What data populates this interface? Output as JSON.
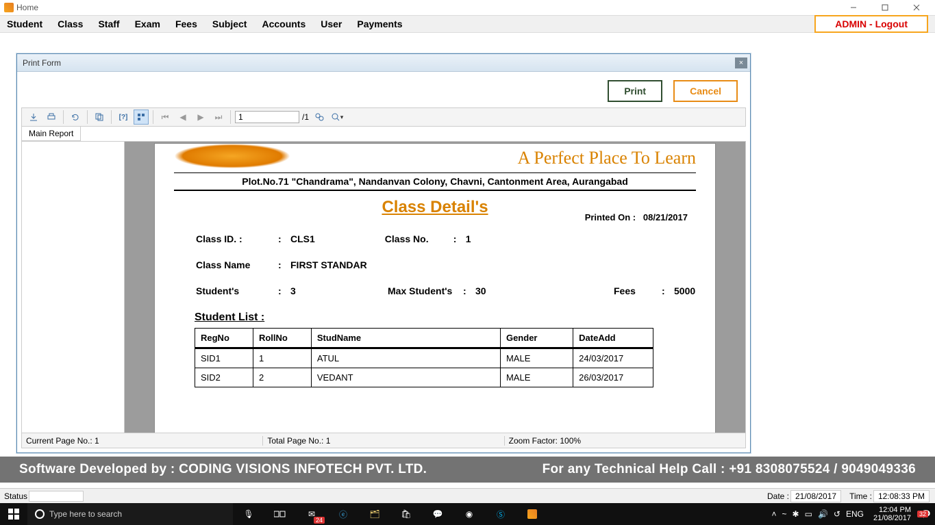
{
  "window": {
    "title": "Home"
  },
  "menu": {
    "items": [
      "Student",
      "Class",
      "Staff",
      "Exam",
      "Fees",
      "Subject",
      "Accounts",
      "User",
      "Payments"
    ],
    "admin_logout": "ADMIN - Logout"
  },
  "modal": {
    "title": "Print Form",
    "print": "Print",
    "cancel": "Cancel",
    "toolbar": {
      "page_val": "1",
      "page_total": "/1"
    },
    "tab": "Main Report",
    "status": {
      "cur": "Current Page No.: 1",
      "total": "Total Page No.: 1",
      "zoom": "Zoom Factor: 100%"
    }
  },
  "report": {
    "tagline": "A Perfect Place To Learn",
    "address": "Plot.No.71 \"Chandrama\", Nandanvan Colony, Chavni, Cantonment Area, Aurangabad",
    "title": "Class Detail's",
    "printed_label": "Printed On  :",
    "printed_date": "08/21/2017",
    "fields": {
      "class_id_l": "Class ID. :",
      "class_id_v": "CLS1",
      "class_no_l": "Class No.",
      "class_no_v": "1",
      "class_name_l": "Class Name",
      "class_name_v": "FIRST STANDAR",
      "students_l": "Student's",
      "students_v": "3",
      "max_l": "Max Student's",
      "max_v": "30",
      "fees_l": "Fees",
      "fees_v": "5000"
    },
    "list_header": "Student List :",
    "columns": [
      "RegNo",
      "RollNo",
      "StudName",
      "Gender",
      "DateAdd"
    ],
    "rows": [
      [
        "SID1",
        "1",
        "ATUL",
        "MALE",
        "24/03/2017"
      ],
      [
        "SID2",
        "2",
        "VEDANT",
        "MALE",
        "26/03/2017"
      ]
    ]
  },
  "footer": {
    "left": "Software Developed by : CODING VISIONS INFOTECH PVT. LTD.",
    "right": "For any Technical Help Call : +91 8308075524 / 9049049336"
  },
  "statusbar": {
    "status_l": "Status",
    "date_l": "Date :",
    "date_v": "21/08/2017",
    "time_l": "Time :",
    "time_v": "12:08:33 PM"
  },
  "taskbar": {
    "search_placeholder": "Type here to search",
    "mail_badge": "24",
    "lang": "ENG",
    "clock_time": "12:04 PM",
    "clock_date": "21/08/2017",
    "notif_badge": "32"
  }
}
